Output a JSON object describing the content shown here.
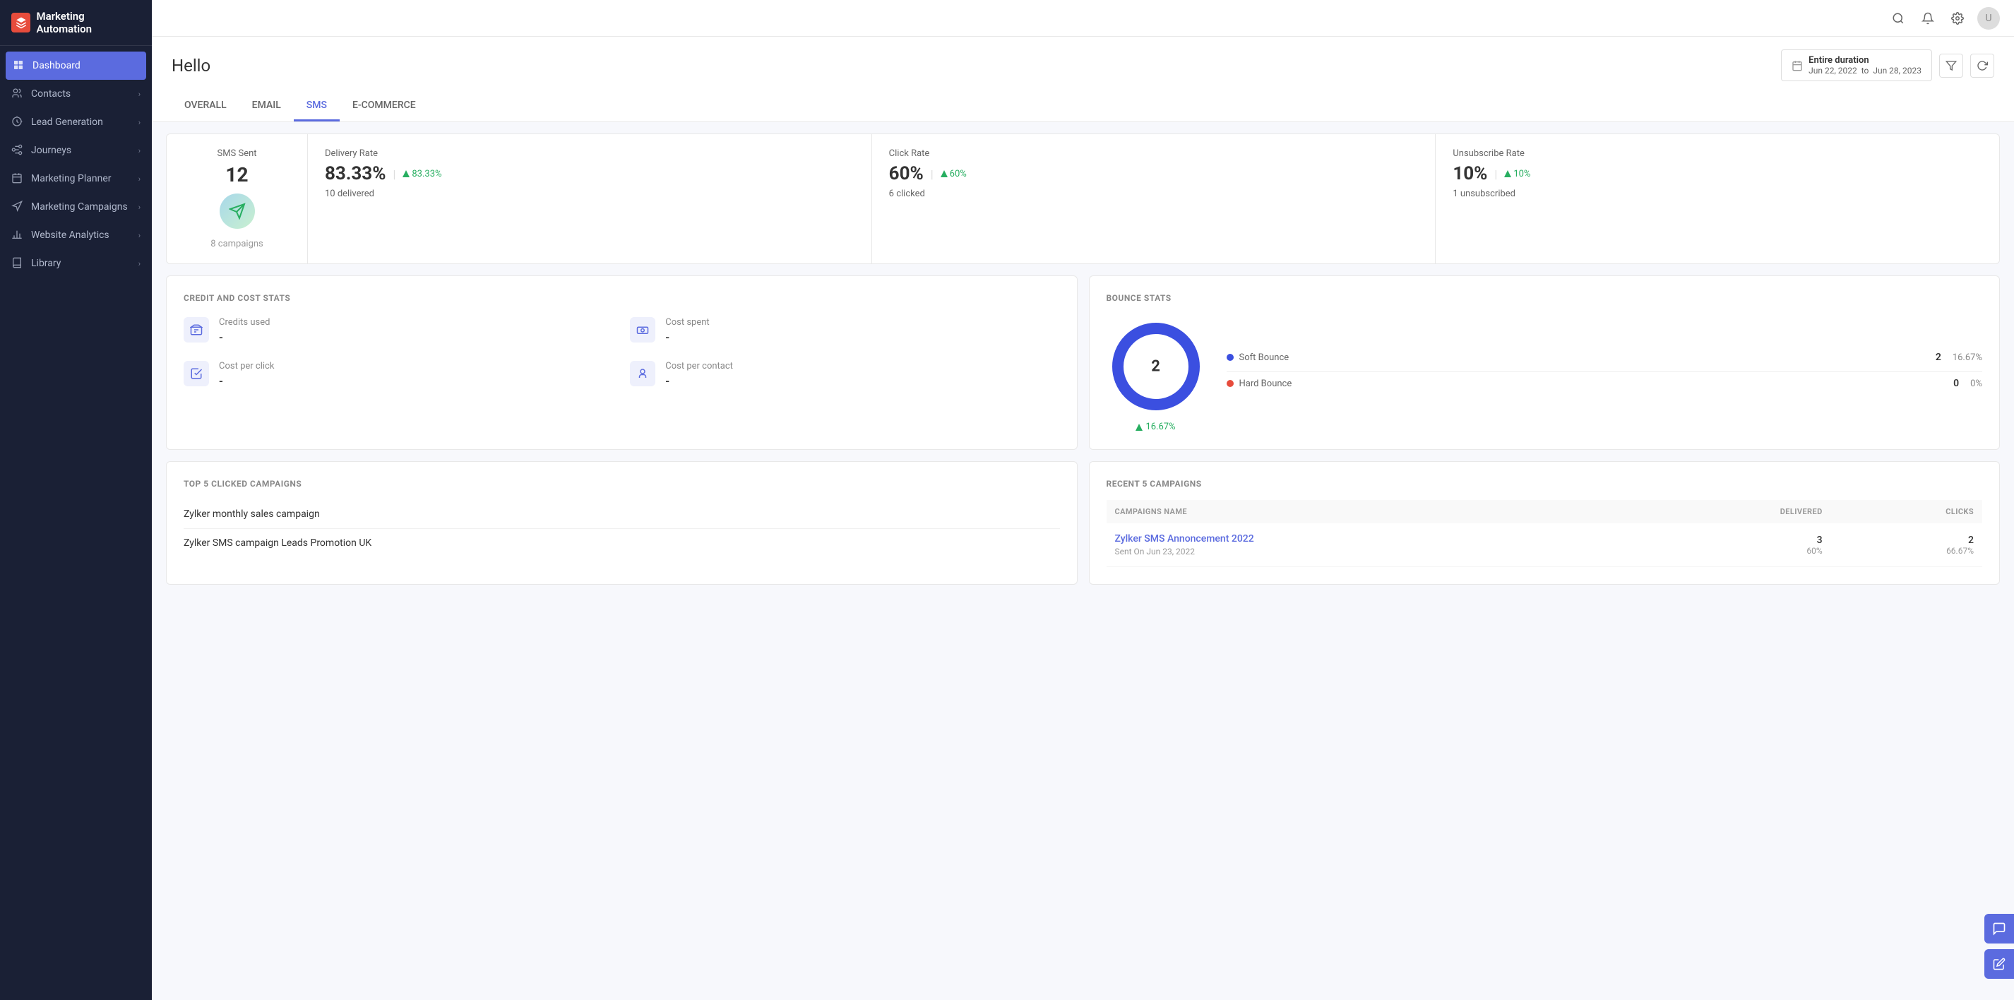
{
  "app": {
    "title": "Marketing Automation",
    "logo_symbol": "🏷"
  },
  "sidebar": {
    "items": [
      {
        "id": "dashboard",
        "label": "Dashboard",
        "active": true,
        "icon": "grid"
      },
      {
        "id": "contacts",
        "label": "Contacts",
        "active": false,
        "icon": "people",
        "has_arrow": true
      },
      {
        "id": "lead-generation",
        "label": "Lead Generation",
        "active": false,
        "icon": "target",
        "has_arrow": true
      },
      {
        "id": "journeys",
        "label": "Journeys",
        "active": false,
        "icon": "route",
        "has_arrow": true
      },
      {
        "id": "marketing-planner",
        "label": "Marketing Planner",
        "active": false,
        "icon": "calendar",
        "has_arrow": true
      },
      {
        "id": "marketing-campaigns",
        "label": "Marketing Campaigns",
        "active": false,
        "icon": "megaphone",
        "has_arrow": true
      },
      {
        "id": "website-analytics",
        "label": "Website Analytics",
        "active": false,
        "icon": "chart",
        "has_arrow": true
      },
      {
        "id": "library",
        "label": "Library",
        "active": false,
        "icon": "book",
        "has_arrow": true
      }
    ]
  },
  "topbar": {
    "search_title": "Search",
    "notifications_title": "Notifications",
    "settings_title": "Settings",
    "avatar_text": "U"
  },
  "page": {
    "title": "Hello",
    "date_range_label": "Entire duration",
    "date_from": "Jun 22, 2022",
    "date_to": "Jun 28, 2023",
    "date_separator": "to"
  },
  "tabs": [
    {
      "id": "overall",
      "label": "OVERALL",
      "active": false
    },
    {
      "id": "email",
      "label": "EMAIL",
      "active": false
    },
    {
      "id": "sms",
      "label": "SMS",
      "active": true
    },
    {
      "id": "ecommerce",
      "label": "E-COMMERCE",
      "active": false
    }
  ],
  "sms_stats": {
    "sent_label": "SMS Sent",
    "sent_value": "12",
    "campaigns_label": "8 campaigns",
    "delivery_rate_label": "Delivery Rate",
    "delivery_rate_value": "83.33%",
    "delivery_rate_change": "83.33%",
    "delivery_rate_detail": "10 delivered",
    "click_rate_label": "Click Rate",
    "click_rate_value": "60%",
    "click_rate_change": "60%",
    "click_rate_detail": "6 clicked",
    "unsubscribe_rate_label": "Unsubscribe Rate",
    "unsubscribe_rate_value": "10%",
    "unsubscribe_rate_change": "10%",
    "unsubscribe_rate_detail": "1 unsubscribed"
  },
  "credit_stats": {
    "section_title": "CREDIT AND COST STATS",
    "credits_used_label": "Credits used",
    "credits_used_value": "-",
    "cost_spent_label": "Cost spent",
    "cost_spent_value": "-",
    "cost_per_click_label": "Cost per click",
    "cost_per_click_value": "-",
    "cost_per_contact_label": "Cost per contact",
    "cost_per_contact_value": "-"
  },
  "bounce_stats": {
    "section_title": "BOUNCE STATS",
    "donut_center": "2",
    "soft_bounce_label": "Soft Bounce",
    "soft_bounce_count": "2",
    "soft_bounce_pct": "16.67%",
    "hard_bounce_label": "Hard Bounce",
    "hard_bounce_count": "0",
    "hard_bounce_pct": "0%",
    "change_value": "16.67%"
  },
  "top_campaigns": {
    "section_title": "TOP 5 CLICKED CAMPAIGNS",
    "items": [
      {
        "label": "Zylker monthly sales campaign"
      },
      {
        "label": "Zylker SMS campaign Leads Promotion UK"
      }
    ]
  },
  "recent_campaigns": {
    "section_title": "RECENT 5 CAMPAIGNS",
    "columns": [
      {
        "id": "name",
        "label": "CAMPAIGNS NAME"
      },
      {
        "id": "delivered",
        "label": "DELIVERED"
      },
      {
        "id": "clicks",
        "label": "CLICKS"
      }
    ],
    "rows": [
      {
        "name": "Zylker SMS Annoncement 2022",
        "sent_date": "Sent On Jun 23, 2022",
        "delivered_count": "3",
        "delivered_pct": "60%",
        "clicks": "2",
        "clicks_pct": "66.67%"
      }
    ]
  }
}
